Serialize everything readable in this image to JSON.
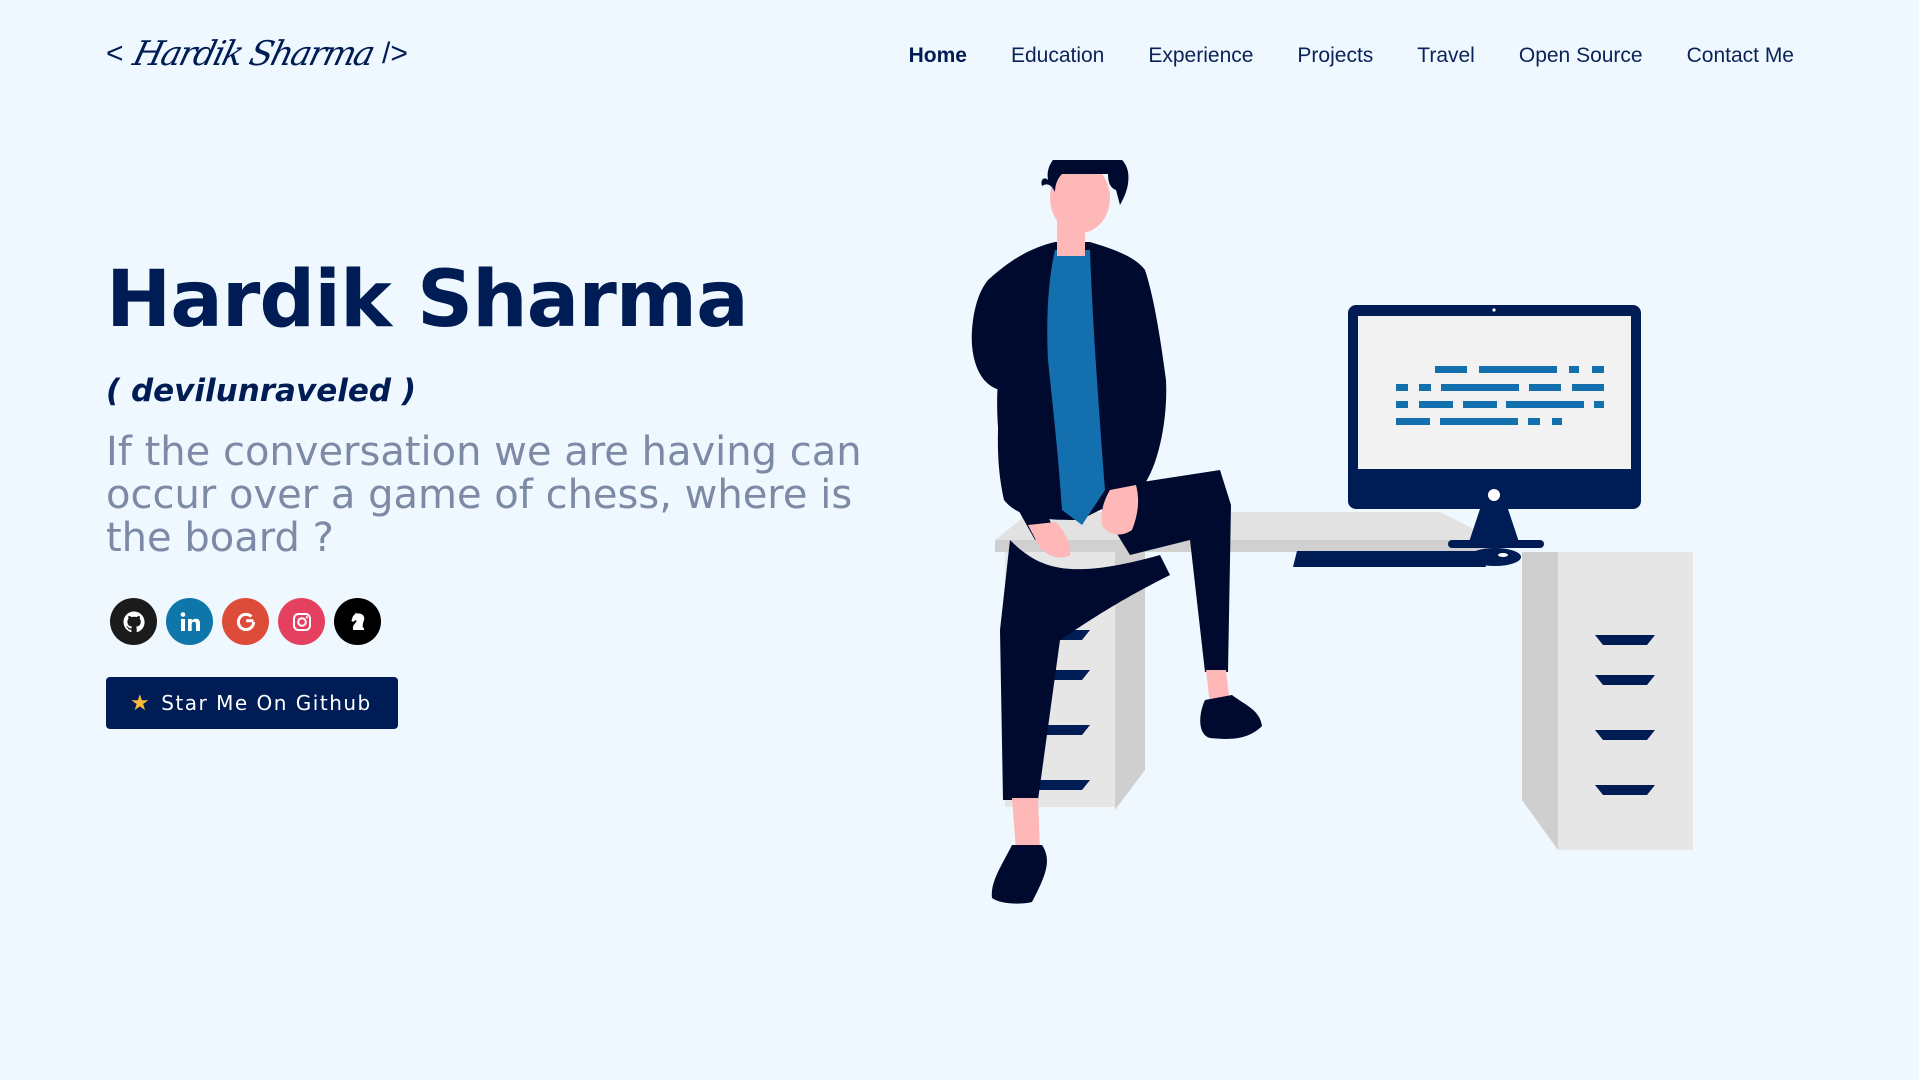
{
  "logo": {
    "open": "<",
    "signature": "Hardik Sharma",
    "close": "/>"
  },
  "nav": {
    "items": [
      "Home",
      "Education",
      "Experience",
      "Projects",
      "Travel",
      "Open Source",
      "Contact Me"
    ],
    "active": "Home"
  },
  "hero": {
    "name": "Hardik Sharma",
    "handle": "( devilunraveled )",
    "quote": "If the conversation we are having can occur over a game of chess, where is the board ?"
  },
  "socials": [
    {
      "name": "GitHub",
      "icon": "github-icon",
      "color": "#1b1b1b"
    },
    {
      "name": "LinkedIn",
      "icon": "linkedin-icon",
      "color": "#0e76a8"
    },
    {
      "name": "Google",
      "icon": "google-icon",
      "color": "#dd4b39"
    },
    {
      "name": "Instagram",
      "icon": "instagram-icon",
      "color": "#e4405f"
    },
    {
      "name": "Chess",
      "icon": "chess-knight-icon",
      "color": "#000000"
    }
  ],
  "cta": {
    "label": "Star Me On Github",
    "icon": "star-icon"
  },
  "colors": {
    "background": "#eef8fe",
    "primary": "#001c55",
    "quote": "#7c8aa5",
    "accent": "#f6b93b"
  }
}
